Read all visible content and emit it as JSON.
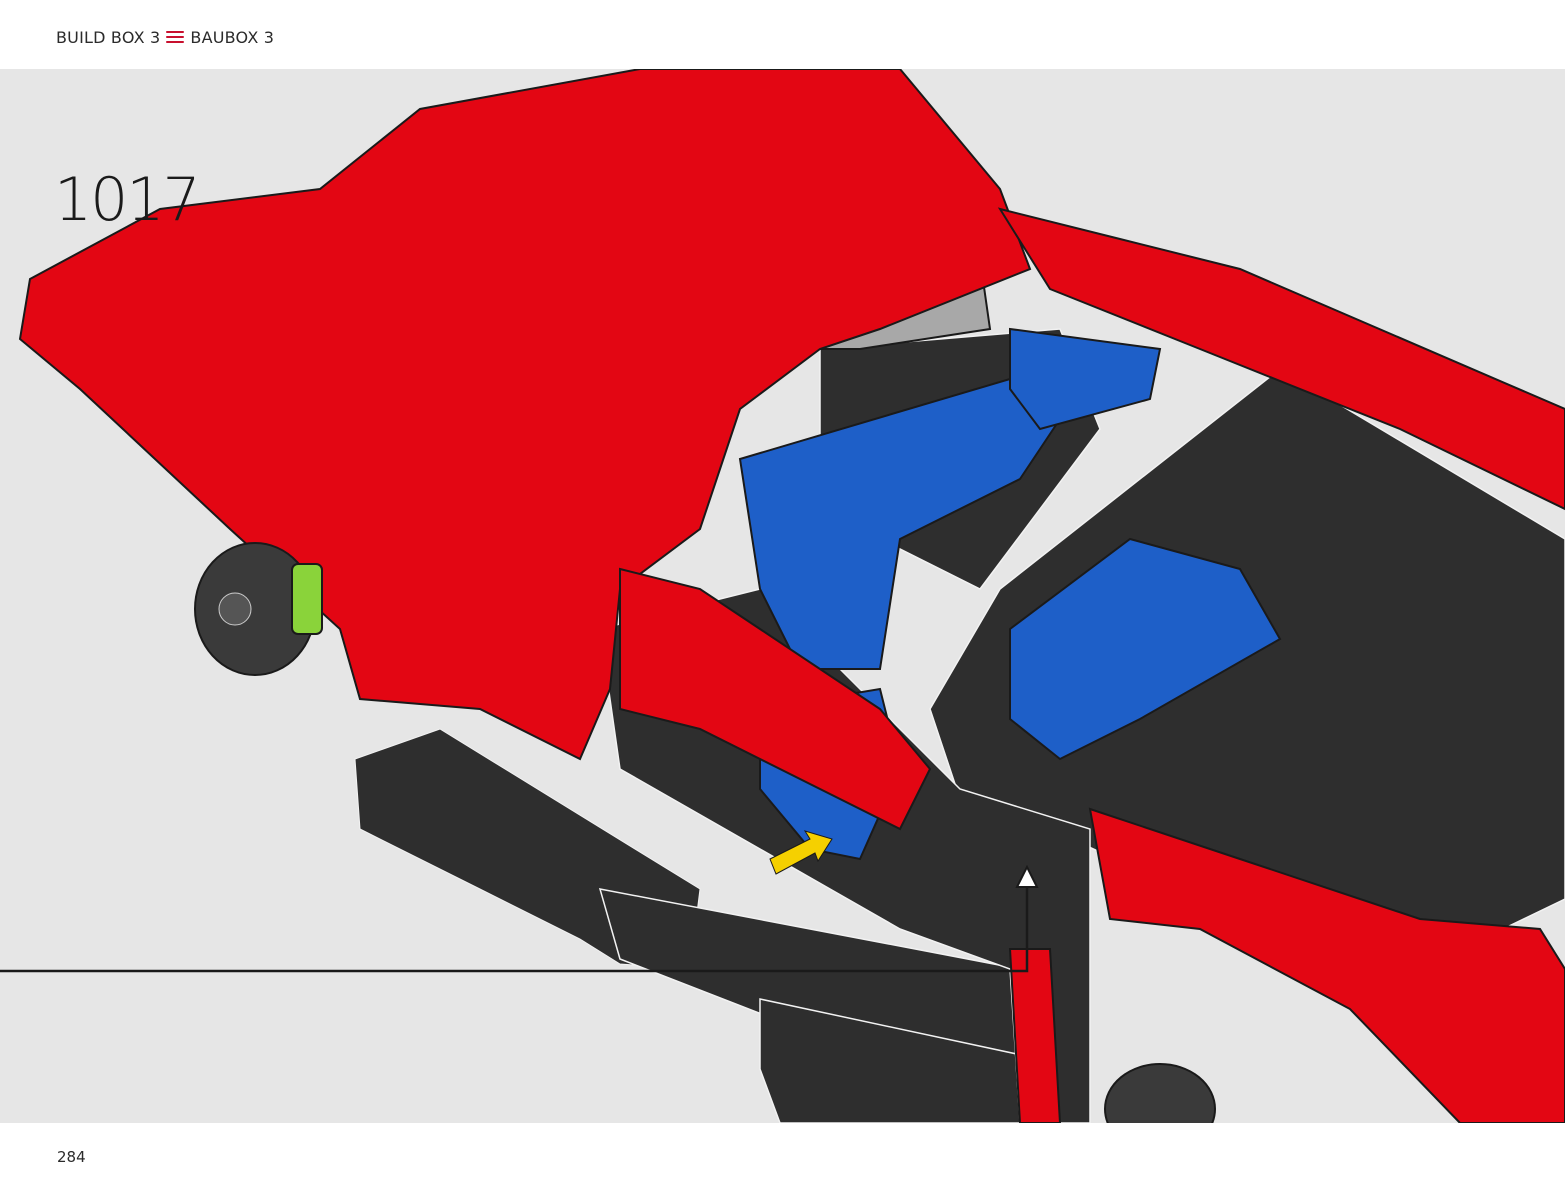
{
  "header": {
    "build_box": "BUILD BOX 3",
    "baubox": "BAUBOX 3",
    "menu_icon": "menu-lines-icon"
  },
  "step": {
    "number": "1017"
  },
  "footer": {
    "page_number": "284"
  },
  "colors": {
    "panel_background": "#e6e6e6",
    "accent_red": "#c8102e",
    "body_red": "#e30613",
    "frame_black": "#2e2e2e",
    "part_blue": "#1e5fc8",
    "part_gray": "#a8a8a8",
    "arrow_yellow": "#f5d000",
    "part_lime": "#8ad33a"
  }
}
